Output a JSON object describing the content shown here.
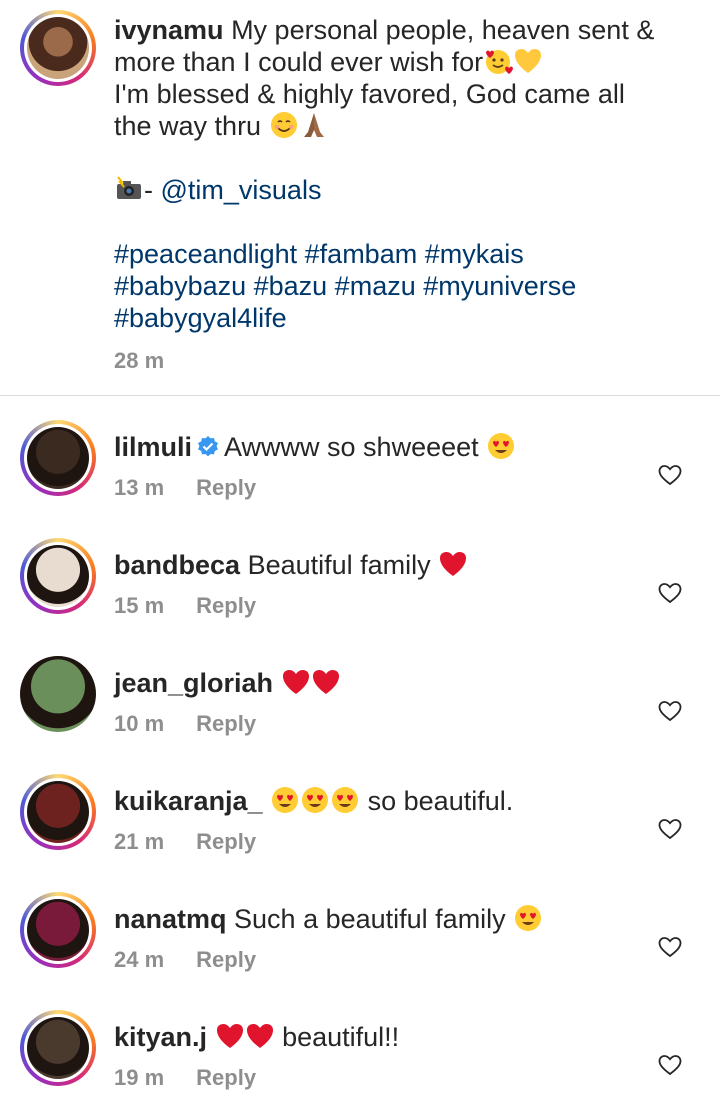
{
  "post": {
    "username": "ivynamu",
    "lines": [
      "My personal people, heaven sent &",
      "more than I could ever wish for",
      "I'm blessed & highly favored, God came all",
      "the way thru"
    ],
    "credit_prefix": "- ",
    "credit_handle": "@tim_visuals",
    "hashtag_lines": [
      "#peaceandlight #fambam #mykais",
      "#babybazu #bazu #mazu #myuniverse",
      "#babygyal4life"
    ],
    "time": "28 m",
    "icons": {
      "line2_end": [
        "smiling-face-with-hearts-icon",
        "yellow-heart-icon"
      ],
      "line4_end": [
        "smiling-face-icon",
        "folded-hands-icon"
      ],
      "credit": "camera-with-flash-icon"
    }
  },
  "comments": [
    {
      "username": "lilmuli",
      "verified": true,
      "text_before": "Awwww so shweeeet",
      "text_after": "",
      "emojis": [
        "heart-eyes"
      ],
      "time": "13 m",
      "reply": "Reply",
      "ring": true,
      "photo_color": "#3a2a20"
    },
    {
      "username": "bandbeca",
      "verified": false,
      "text_before": "Beautiful family",
      "text_after": "",
      "emojis": [
        "red-heart"
      ],
      "time": "15 m",
      "reply": "Reply",
      "ring": true,
      "photo_color": "#e8dcd0"
    },
    {
      "username": "jean_gloriah",
      "verified": false,
      "text_before": "",
      "text_after": "",
      "emojis": [
        "red-heart",
        "red-heart"
      ],
      "time": "10 m",
      "reply": "Reply",
      "ring": false,
      "photo_color": "#6b8f5a"
    },
    {
      "username": "kuikaranja_",
      "verified": false,
      "text_before": "",
      "text_after": "so beautiful.",
      "emojis": [
        "heart-eyes",
        "heart-eyes",
        "heart-eyes"
      ],
      "time": "21 m",
      "reply": "Reply",
      "ring": true,
      "photo_color": "#6e2220"
    },
    {
      "username": "nanatmq",
      "verified": false,
      "text_before": "Such a beautiful family",
      "text_after": "",
      "emojis": [
        "heart-eyes"
      ],
      "time": "24 m",
      "reply": "Reply",
      "ring": true,
      "photo_color": "#7a1a3a"
    },
    {
      "username": "kityan.j",
      "verified": false,
      "text_before": "",
      "text_after": "beautiful!!",
      "emojis": [
        "red-heart",
        "red-heart"
      ],
      "time": "19 m",
      "reply": "Reply",
      "ring": true,
      "photo_color": "#4a3a2e"
    }
  ],
  "colors": {
    "link": "#00376b",
    "meta": "#8e8e8e",
    "verified": "#3897f0",
    "heart": "#e0142c"
  }
}
